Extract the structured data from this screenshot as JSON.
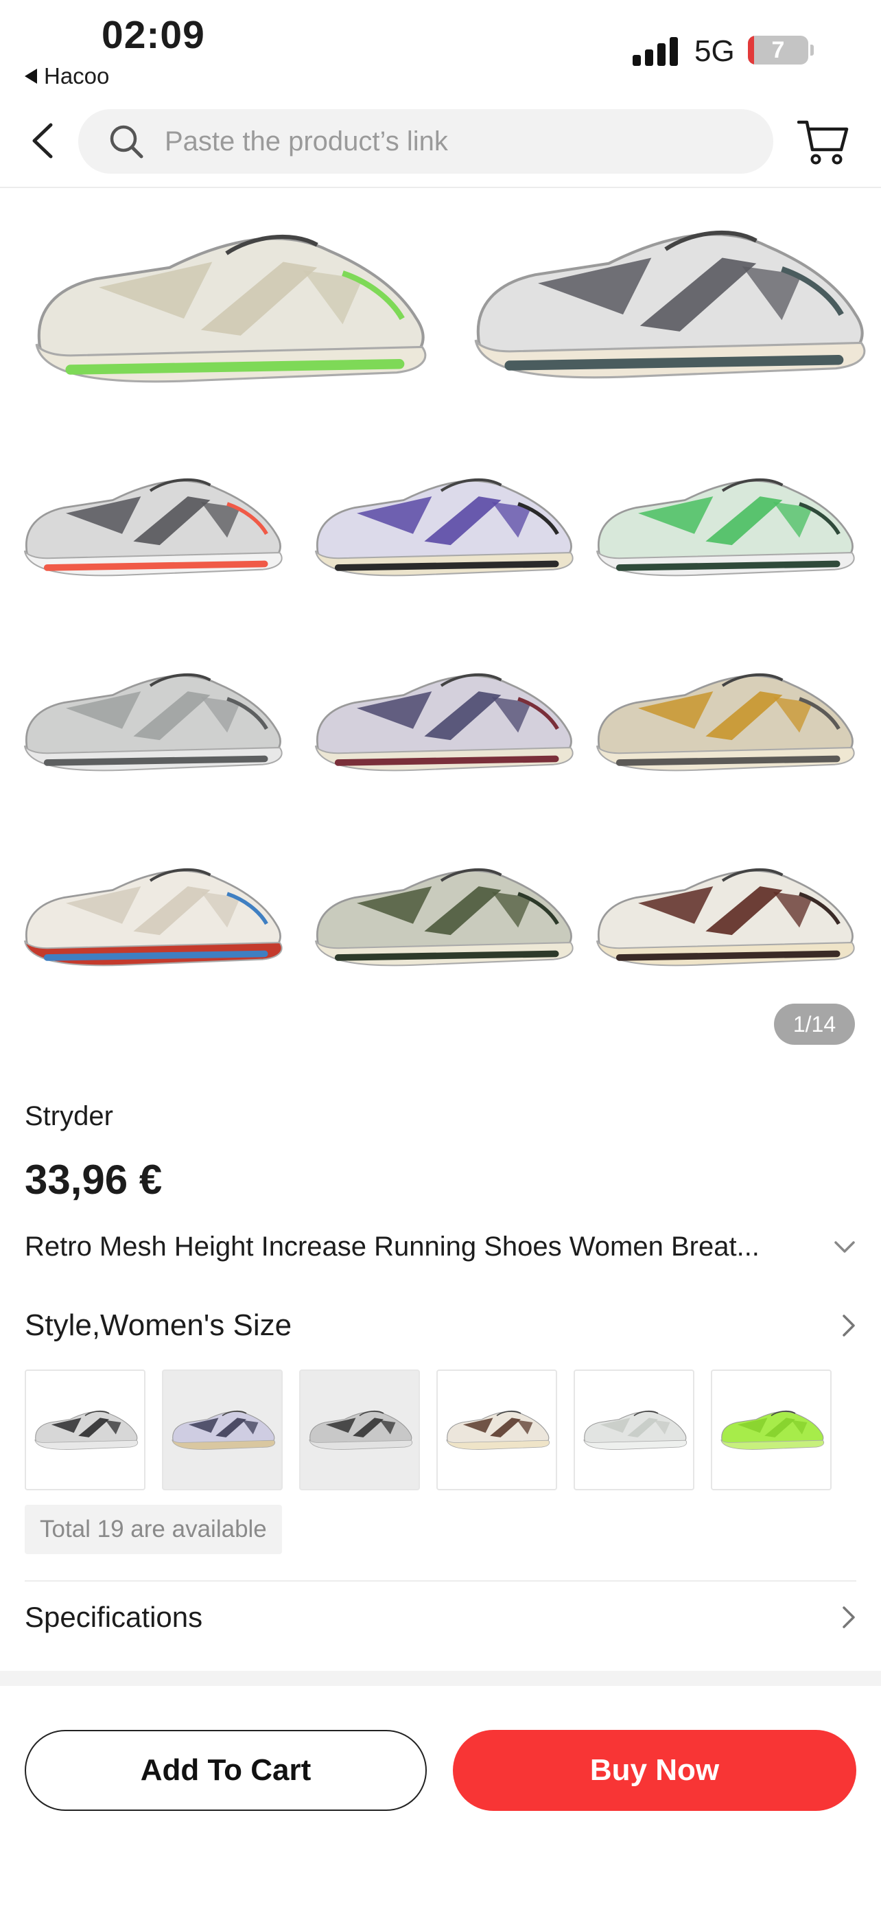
{
  "status_bar": {
    "time": "02:09",
    "back_app": "Hacoo",
    "network": "5G",
    "battery": "7"
  },
  "header": {
    "search_placeholder": "Paste the product’s link"
  },
  "gallery": {
    "counter": "1/14",
    "shoes": [
      {
        "upper": "#e8e6dc",
        "accent": "#cfc9b3",
        "sole": "#ece8da",
        "trim": "#7ed957"
      },
      {
        "upper": "#e1e1e1",
        "accent": "#5b5b62",
        "sole": "#efe7d7",
        "trim": "#4a5c5e"
      },
      {
        "upper": "#d9d9d9",
        "accent": "#55555a",
        "sole": "#f2f2f2",
        "trim": "#f05a47"
      },
      {
        "upper": "#dcdaea",
        "accent": "#5b4aa6",
        "sole": "#ece4cc",
        "trim": "#2a2a2a"
      },
      {
        "upper": "#d8e8da",
        "accent": "#4bbf62",
        "sole": "#efefef",
        "trim": "#2f4a3a"
      },
      {
        "upper": "#cfd0cf",
        "accent": "#9fa2a1",
        "sole": "#e8e8e8",
        "trim": "#5d5f60"
      },
      {
        "upper": "#d4d0dc",
        "accent": "#4d4a70",
        "sole": "#ece6d4",
        "trim": "#7a2f3a"
      },
      {
        "upper": "#d8cfb8",
        "accent": "#c9962e",
        "sole": "#efe7d2",
        "trim": "#5c5a57"
      },
      {
        "upper": "#eeeae2",
        "accent": "#d4ccbd",
        "sole": "#c43a2c",
        "trim": "#3f7fc2"
      },
      {
        "upper": "#c9cbbd",
        "accent": "#4d5a3c",
        "sole": "#ede8d6",
        "trim": "#2d3a2a"
      },
      {
        "upper": "#ece9e1",
        "accent": "#5e2b24",
        "sole": "#efe4c8",
        "trim": "#3a2a26"
      }
    ]
  },
  "product": {
    "brand": "Stryder",
    "price": "33,96 €",
    "title": "Retro Mesh Height Increase Running Shoes Women Breat...",
    "style_label": "Style,Women's Size",
    "variants": [
      {
        "upper": "#d7d7d7",
        "accent": "#2c2c2e",
        "sole": "#e8e8e8",
        "bg": "white"
      },
      {
        "upper": "#cfcde2",
        "accent": "#3d3d58",
        "sole": "#d9c7a0",
        "bg": "gray"
      },
      {
        "upper": "#c8c8c8",
        "accent": "#333333",
        "sole": "#e2e2e2",
        "bg": "gray"
      },
      {
        "upper": "#ece6dc",
        "accent": "#5b3a2c",
        "sole": "#efe4c8",
        "bg": "white"
      },
      {
        "upper": "#e2e4e2",
        "accent": "#c7cbc6",
        "sole": "#eef0ee",
        "bg": "white"
      },
      {
        "upper": "#a7ec4a",
        "accent": "#86d12c",
        "sole": "#c7f07d",
        "bg": "white"
      }
    ],
    "availability": "Total 19 are available",
    "specifications": "Specifications"
  },
  "actions": {
    "add_to_cart": "Add To Cart",
    "buy_now": "Buy Now"
  },
  "colors": {
    "accent": "#f83535"
  }
}
